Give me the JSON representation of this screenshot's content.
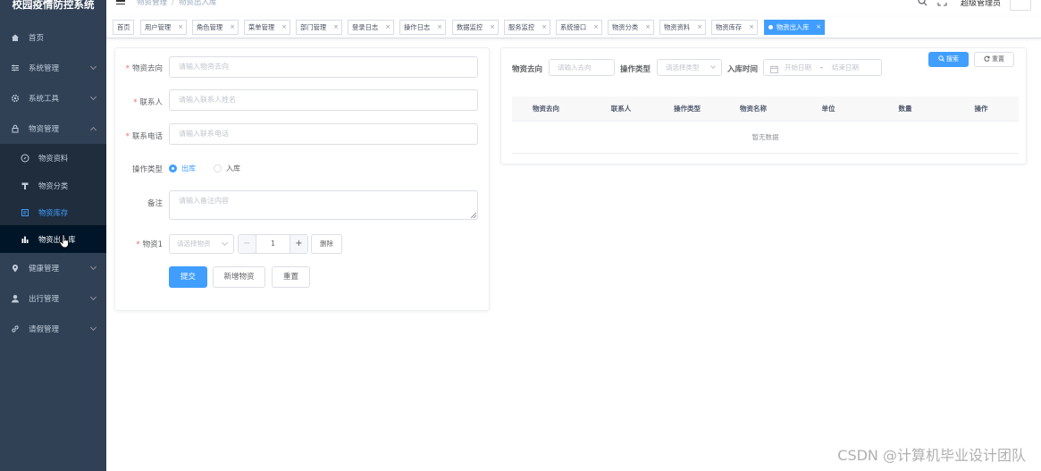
{
  "app": {
    "title": "校园疫情防控系统"
  },
  "sidebar": {
    "items": [
      {
        "label": "首页",
        "icon": "home-icon"
      },
      {
        "label": "系统管理",
        "icon": "settings-sliders-icon"
      },
      {
        "label": "系统工具",
        "icon": "gear-icon"
      },
      {
        "label": "物资管理",
        "icon": "lock-icon"
      },
      {
        "label": "健康管理",
        "icon": "location-icon"
      },
      {
        "label": "出行管理",
        "icon": "user-icon"
      },
      {
        "label": "请假管理",
        "icon": "link-icon"
      }
    ],
    "sub_items": [
      {
        "label": "物资资料",
        "icon": "compass-icon"
      },
      {
        "label": "物资分类",
        "icon": "filter-icon"
      },
      {
        "label": "物资库存",
        "icon": "storage-icon"
      },
      {
        "label": "物资出入库",
        "icon": "bar-chart-icon"
      }
    ]
  },
  "navbar": {
    "breadcrumb": [
      "物资管理",
      "物资出入库"
    ],
    "username": "超级管理员"
  },
  "tags": [
    {
      "label": "首页"
    },
    {
      "label": "用户管理"
    },
    {
      "label": "角色管理"
    },
    {
      "label": "菜单管理"
    },
    {
      "label": "部门管理"
    },
    {
      "label": "登录日志"
    },
    {
      "label": "操作日志"
    },
    {
      "label": "数据监控"
    },
    {
      "label": "服务监控"
    },
    {
      "label": "系统接口"
    },
    {
      "label": "物资分类"
    },
    {
      "label": "物资资料"
    },
    {
      "label": "物资库存"
    },
    {
      "label": "物资出入库"
    }
  ],
  "form": {
    "direction_label": "物资去向",
    "direction_placeholder": "请输入物资去向",
    "contact_label": "联系人",
    "contact_placeholder": "请输入联系人姓名",
    "phone_label": "联系电话",
    "phone_placeholder": "请输入联系电话",
    "op_type_label": "操作类型",
    "op_out": "出库",
    "op_in": "入库",
    "remark_label": "备注",
    "remark_placeholder": "请输入备注内容",
    "item_label": "物资1",
    "item_placeholder": "请选择物资",
    "quantity": "1",
    "delete_label": "删除",
    "submit_label": "提交",
    "add_item_label": "新增物资",
    "reset_label": "重置"
  },
  "query": {
    "direction_label": "物资去向",
    "direction_placeholder": "请输入去向",
    "op_type_label": "操作类型",
    "op_type_placeholder": "请选择类型",
    "time_label": "入库时间",
    "start_placeholder": "开始日期",
    "range_sep": "-",
    "end_placeholder": "结束日期",
    "search_label": "搜索",
    "reset_label": "重置"
  },
  "table": {
    "columns": [
      "物资去向",
      "联系人",
      "操作类型",
      "物资名称",
      "单位",
      "数量",
      "操作"
    ],
    "empty_text": "暂无数据"
  },
  "watermark": "CSDN @计算机毕业设计团队",
  "colors": {
    "sidebar_bg": "#304156",
    "submenu_bg": "#1f2d3d",
    "primary": "#409eff",
    "tag_active": "#409eff"
  }
}
